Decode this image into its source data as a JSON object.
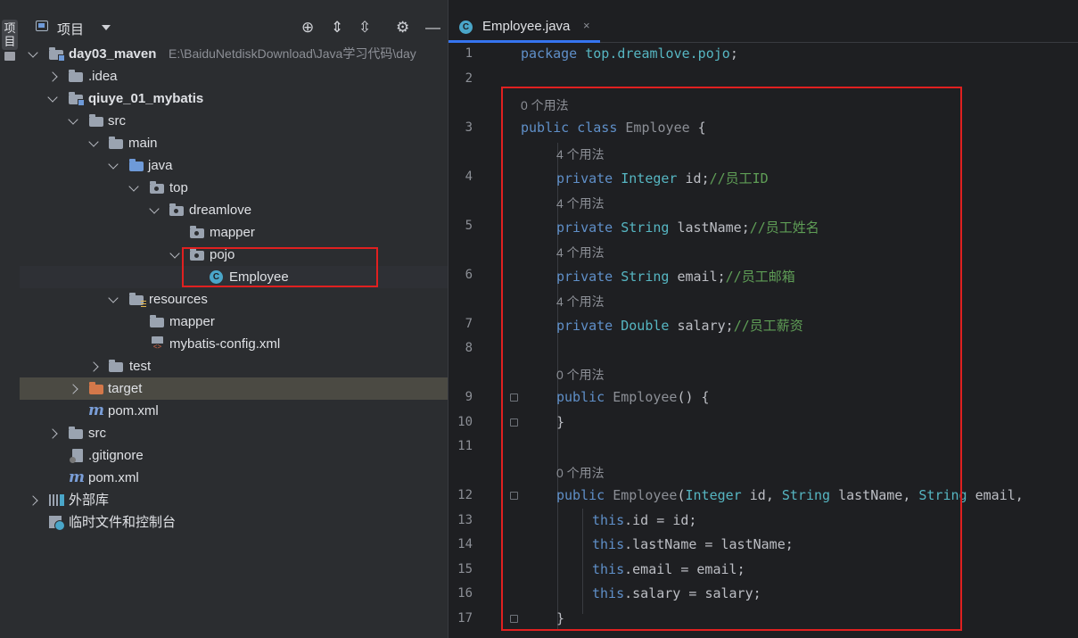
{
  "sidebar_strip": {
    "label": "项目"
  },
  "project_panel": {
    "title": "项目",
    "tree": [
      {
        "label": "day03_maven",
        "path": "E:\\BaiduNetdiskDownload\\Java学习代码\\day"
      },
      {
        "label": ".idea"
      },
      {
        "label": "qiuye_01_mybatis"
      },
      {
        "label": "src"
      },
      {
        "label": "main"
      },
      {
        "label": "java"
      },
      {
        "label": "top"
      },
      {
        "label": "dreamlove"
      },
      {
        "label": "mapper"
      },
      {
        "label": "pojo"
      },
      {
        "label": "Employee"
      },
      {
        "label": "resources"
      },
      {
        "label": "mapper"
      },
      {
        "label": "mybatis-config.xml"
      },
      {
        "label": "test"
      },
      {
        "label": "target"
      },
      {
        "label": "pom.xml"
      },
      {
        "label": "src"
      },
      {
        "label": ".gitignore"
      },
      {
        "label": "pom.xml"
      },
      {
        "label": "外部库"
      },
      {
        "label": "临时文件和控制台"
      }
    ]
  },
  "editor": {
    "tab": {
      "label": "Employee.java",
      "close": "×"
    },
    "class_icon": "C",
    "line_numbers": [
      "1",
      "2",
      "3",
      "4",
      "5",
      "6",
      "7",
      "8",
      "9",
      "10",
      "11",
      "12",
      "13",
      "14",
      "15",
      "16",
      "17"
    ],
    "usage_hints": [
      "0 个用法",
      "4 个用法",
      "4 个用法",
      "4 个用法",
      "4 个用法",
      "0 个用法",
      "0 个用法"
    ],
    "tokens": {
      "package_kw": "package",
      "package_name": "top.dreamlove.pojo",
      "semi": ";",
      "public": "public",
      "class": "class",
      "private": "private",
      "this": "this",
      "class_name": "Employee",
      "brace_open": " {",
      "brace_close": "}",
      "empty_ctor_parens": "() {",
      "Integer": "Integer",
      "String": "String",
      "Double": "Double",
      "id": "id",
      "lastName": "lastName",
      "email": "email",
      "salary": "salary",
      "comment_id": "//员工ID",
      "comment_lastName": "//员工姓名",
      "comment_email": "//员工邮箱",
      "comment_salary": "//员工薪资",
      "paren_open": "(",
      "comma": ", ",
      "dot": ".",
      "assign": " = "
    }
  }
}
